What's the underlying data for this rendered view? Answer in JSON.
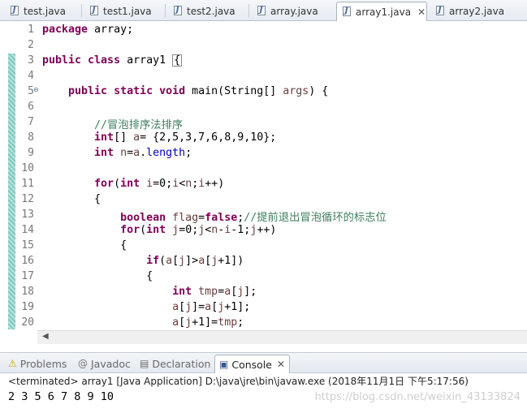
{
  "editor_tabs": [
    {
      "label": "test.java",
      "active": false
    },
    {
      "label": "test1.java",
      "active": false
    },
    {
      "label": "test2.java",
      "active": false
    },
    {
      "label": "array.java",
      "active": false
    },
    {
      "label": "array1.java",
      "active": true
    },
    {
      "label": "array2.java",
      "active": false
    }
  ],
  "close_glyph": "✕",
  "code_lines": [
    {
      "n": "1",
      "html": "<span class='kw'>package</span> array;"
    },
    {
      "n": "2",
      "html": ""
    },
    {
      "n": "3",
      "html": "<span class='kw'>public class</span> array1 <span class='caretbox'>{</span>"
    },
    {
      "n": "4",
      "html": ""
    },
    {
      "n": "5",
      "html": "    <span class='kw'>public static void</span> main(String[] <span class='lv'>args</span>) {"
    },
    {
      "n": "6",
      "html": ""
    },
    {
      "n": "7",
      "html": "        <span class='cm'>//冒泡排序法排序</span>"
    },
    {
      "n": "8",
      "html": "        <span class='kw'>int</span>[] <span class='lv'>a</span>= {2,5,3,7,6,8,9,10};"
    },
    {
      "n": "9",
      "html": "        <span class='kw'>int</span> <span class='lv'>n</span>=<span class='lv'>a</span>.<span class='fd'>length</span>;"
    },
    {
      "n": "10",
      "html": ""
    },
    {
      "n": "11",
      "html": "        <span class='kw'>for</span>(<span class='kw'>int</span> <span class='lv'>i</span>=0;<span class='lv'>i</span>&lt;<span class='lv'>n</span>;<span class='lv'>i</span>++)"
    },
    {
      "n": "12",
      "html": "        {"
    },
    {
      "n": "13",
      "html": "            <span class='kw'>boolean</span> <span class='lv'>flag</span>=<span class='kw'>false</span>;<span class='cm'>//提前退出冒泡循环的标志位</span>"
    },
    {
      "n": "14",
      "html": "            <span class='kw'>for</span>(<span class='kw'>int</span> <span class='lv'>j</span>=0;<span class='lv'>j</span>&lt;<span class='lv'>n</span>-<span class='lv'>i</span>-1;<span class='lv'>j</span>++)"
    },
    {
      "n": "15",
      "html": "            {"
    },
    {
      "n": "16",
      "html": "                <span class='kw'>if</span>(<span class='lv'>a</span>[<span class='lv'>j</span>]&gt;<span class='lv'>a</span>[<span class='lv'>j</span>+1])"
    },
    {
      "n": "17",
      "html": "                {"
    },
    {
      "n": "18",
      "html": "                    <span class='kw'>int</span> <span class='lv'>tmp</span>=<span class='lv'>a</span>[<span class='lv'>j</span>];"
    },
    {
      "n": "19",
      "html": "                    <span class='lv'>a</span>[<span class='lv'>j</span>]=<span class='lv'>a</span>[<span class='lv'>j</span>+1];"
    },
    {
      "n": "20",
      "html": "                    <span class='lv'>a</span>[<span class='lv'>j</span>+1]=<span class='lv'>tmp</span>;"
    }
  ],
  "fold_glyph": "⊖",
  "hscroll_arrow": "◀",
  "panel_tabs": [
    {
      "label": "Problems",
      "icon": "problems-icon",
      "glyph": "⚠",
      "active": false
    },
    {
      "label": "Javadoc",
      "icon": "javadoc-icon",
      "glyph": "@",
      "active": false
    },
    {
      "label": "Declaration",
      "icon": "declaration-icon",
      "glyph": "▤",
      "active": false
    },
    {
      "label": "Console",
      "icon": "console-icon",
      "glyph": "▣",
      "active": true
    }
  ],
  "console": {
    "header": "<terminated> array1 [Java Application] D:\\java\\jre\\bin\\javaw.exe (2018年11月1日 下午5:17:56)",
    "output": "2 3 5 6 7 8 9 10"
  },
  "watermark": "https://blog.csdn.net/weixin_43133824"
}
